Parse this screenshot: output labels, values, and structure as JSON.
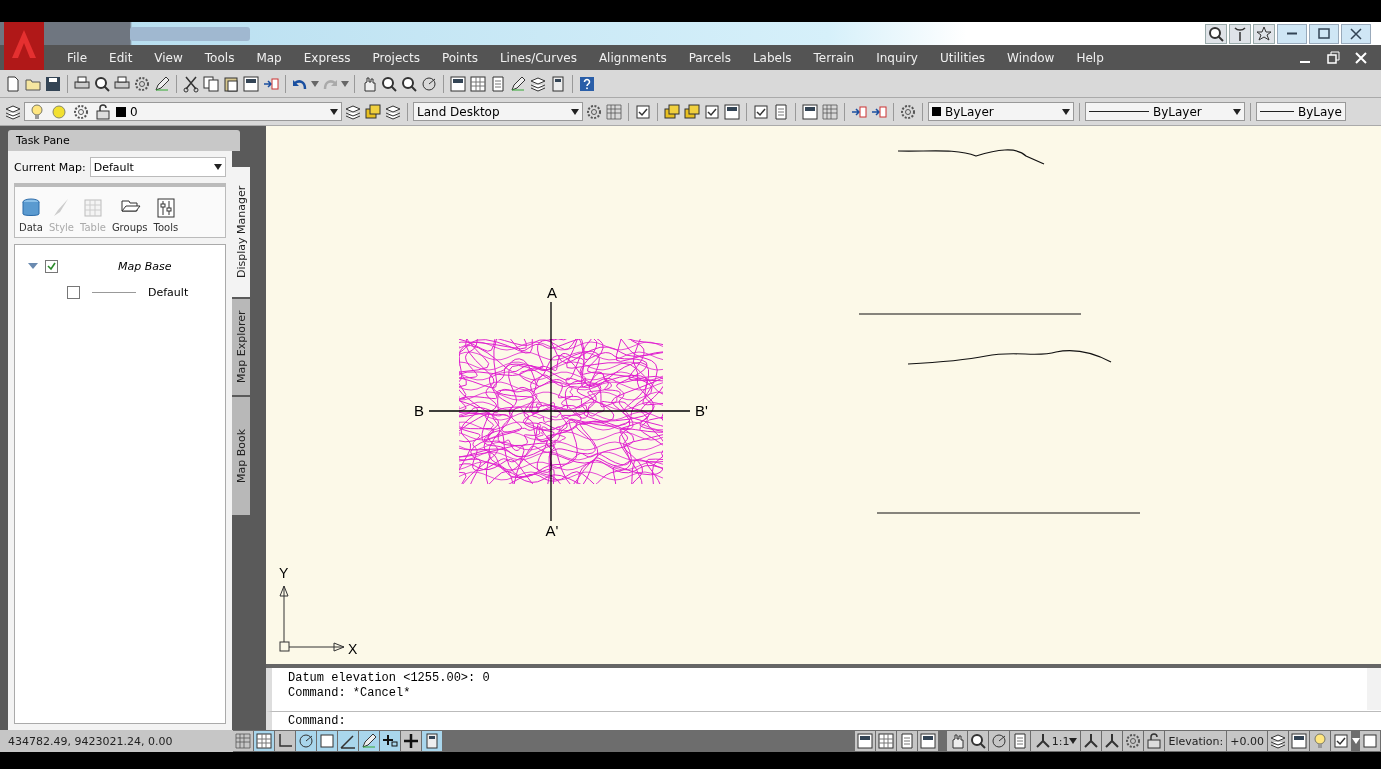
{
  "menu": [
    "File",
    "Edit",
    "View",
    "Tools",
    "Map",
    "Express",
    "Projects",
    "Points",
    "Lines/Curves",
    "Alignments",
    "Parcels",
    "Labels",
    "Terrain",
    "Inquiry",
    "Utilities",
    "Window",
    "Help"
  ],
  "layer_toolbar": {
    "layer": "0"
  },
  "workspace": {
    "value": "Land Desktop"
  },
  "properties": {
    "color_control": "ByLayer",
    "linetype": "ByLayer",
    "lineweight": "ByLaye"
  },
  "task_pane": {
    "title": "Task Pane",
    "current_map_label": "Current Map:",
    "current_map": "Default",
    "tools": [
      {
        "kind": "data",
        "label": "Data",
        "disabled": false
      },
      {
        "kind": "style",
        "label": "Style",
        "disabled": true
      },
      {
        "kind": "table",
        "label": "Table",
        "disabled": true
      },
      {
        "kind": "groups",
        "label": "Groups",
        "disabled": false
      },
      {
        "kind": "tools",
        "label": "Tools",
        "disabled": false
      }
    ],
    "tree": [
      {
        "label": "Map Base",
        "checked": true,
        "expanded": true,
        "children": [
          {
            "label": "Default",
            "checked": false
          }
        ]
      }
    ],
    "side_tabs": [
      {
        "label": "Display Manager",
        "selected": true
      },
      {
        "label": "Map Explorer",
        "selected": false
      },
      {
        "label": "Map Book",
        "selected": false
      }
    ]
  },
  "drawing": {
    "section_labels": {
      "north": "A",
      "south": "A'",
      "west": "B",
      "east": "B'"
    },
    "ucs": {
      "x": "X",
      "y": "Y"
    }
  },
  "command_line": {
    "history": [
      "Datum elevation <1255.00>: 0",
      "Command: *Cancel*"
    ],
    "prompt": "Command:"
  },
  "status_bar": {
    "coordinates": "434782.49, 9423021.24, 0.00",
    "toggles": [
      {
        "kind": "snap",
        "on": false
      },
      {
        "kind": "grid",
        "on": true
      },
      {
        "kind": "ortho",
        "on": false
      },
      {
        "kind": "polar",
        "on": true
      },
      {
        "kind": "osnap",
        "on": true
      },
      {
        "kind": "otrack",
        "on": true
      },
      {
        "kind": "ducs",
        "on": true
      },
      {
        "kind": "dyn",
        "on": true
      },
      {
        "kind": "lwt",
        "on": false
      },
      {
        "kind": "qp",
        "on": true
      }
    ],
    "annotation_scale": "1:1",
    "elevation_label": "Elevation:",
    "elevation": "+0.00"
  }
}
